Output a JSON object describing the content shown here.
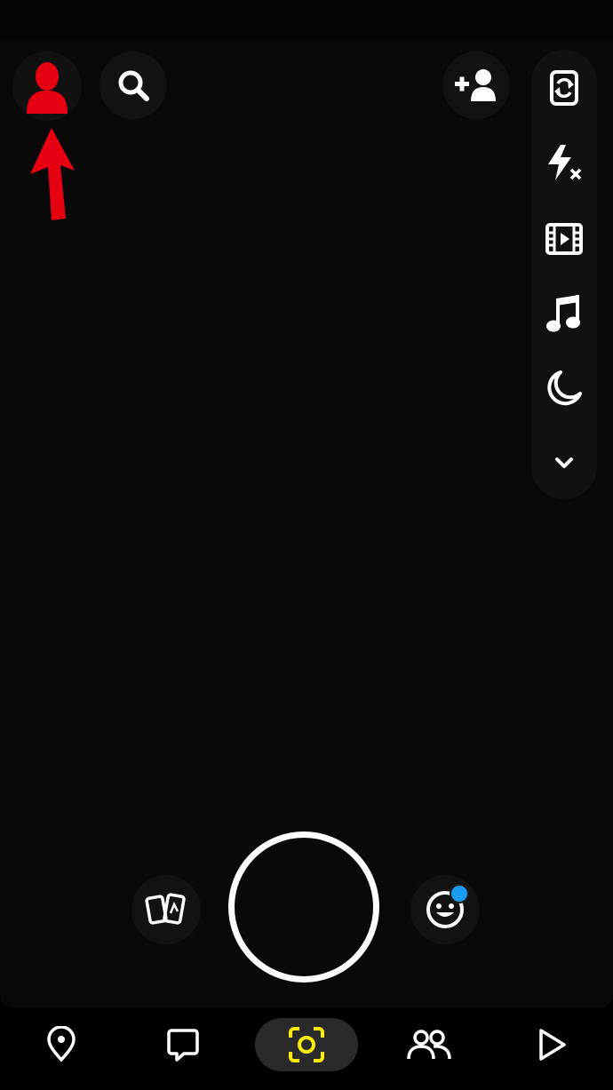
{
  "colors": {
    "background": "#000000",
    "viewfinder": "#0a0909",
    "icon": "#ffffff",
    "annotation_red": "#e60012",
    "active_nav": "#ffeb00",
    "notification_dot": "#1a9bf0"
  },
  "header": {
    "avatar_icon": "bitmoji-avatar-icon",
    "search_icon": "search-icon",
    "add_friend_icon": "add-friend-icon"
  },
  "toolbar": {
    "items": [
      {
        "icon": "flip-camera-icon"
      },
      {
        "icon": "flash-off-icon"
      },
      {
        "icon": "video-clip-icon"
      },
      {
        "icon": "music-note-icon"
      },
      {
        "icon": "night-mode-icon"
      },
      {
        "icon": "chevron-down-icon"
      }
    ]
  },
  "annotation": {
    "icon": "red-arrow-pointing-up"
  },
  "camera_controls": {
    "memories_icon": "memories-icon",
    "shutter": "capture-button",
    "lenses_icon": "lens-smiley-icon",
    "lenses_has_notification": true
  },
  "bottom_nav": {
    "items": [
      {
        "icon": "map-pin-icon"
      },
      {
        "icon": "chat-icon"
      },
      {
        "icon": "camera-icon",
        "active": true
      },
      {
        "icon": "friends-icon"
      },
      {
        "icon": "play-icon"
      }
    ]
  }
}
